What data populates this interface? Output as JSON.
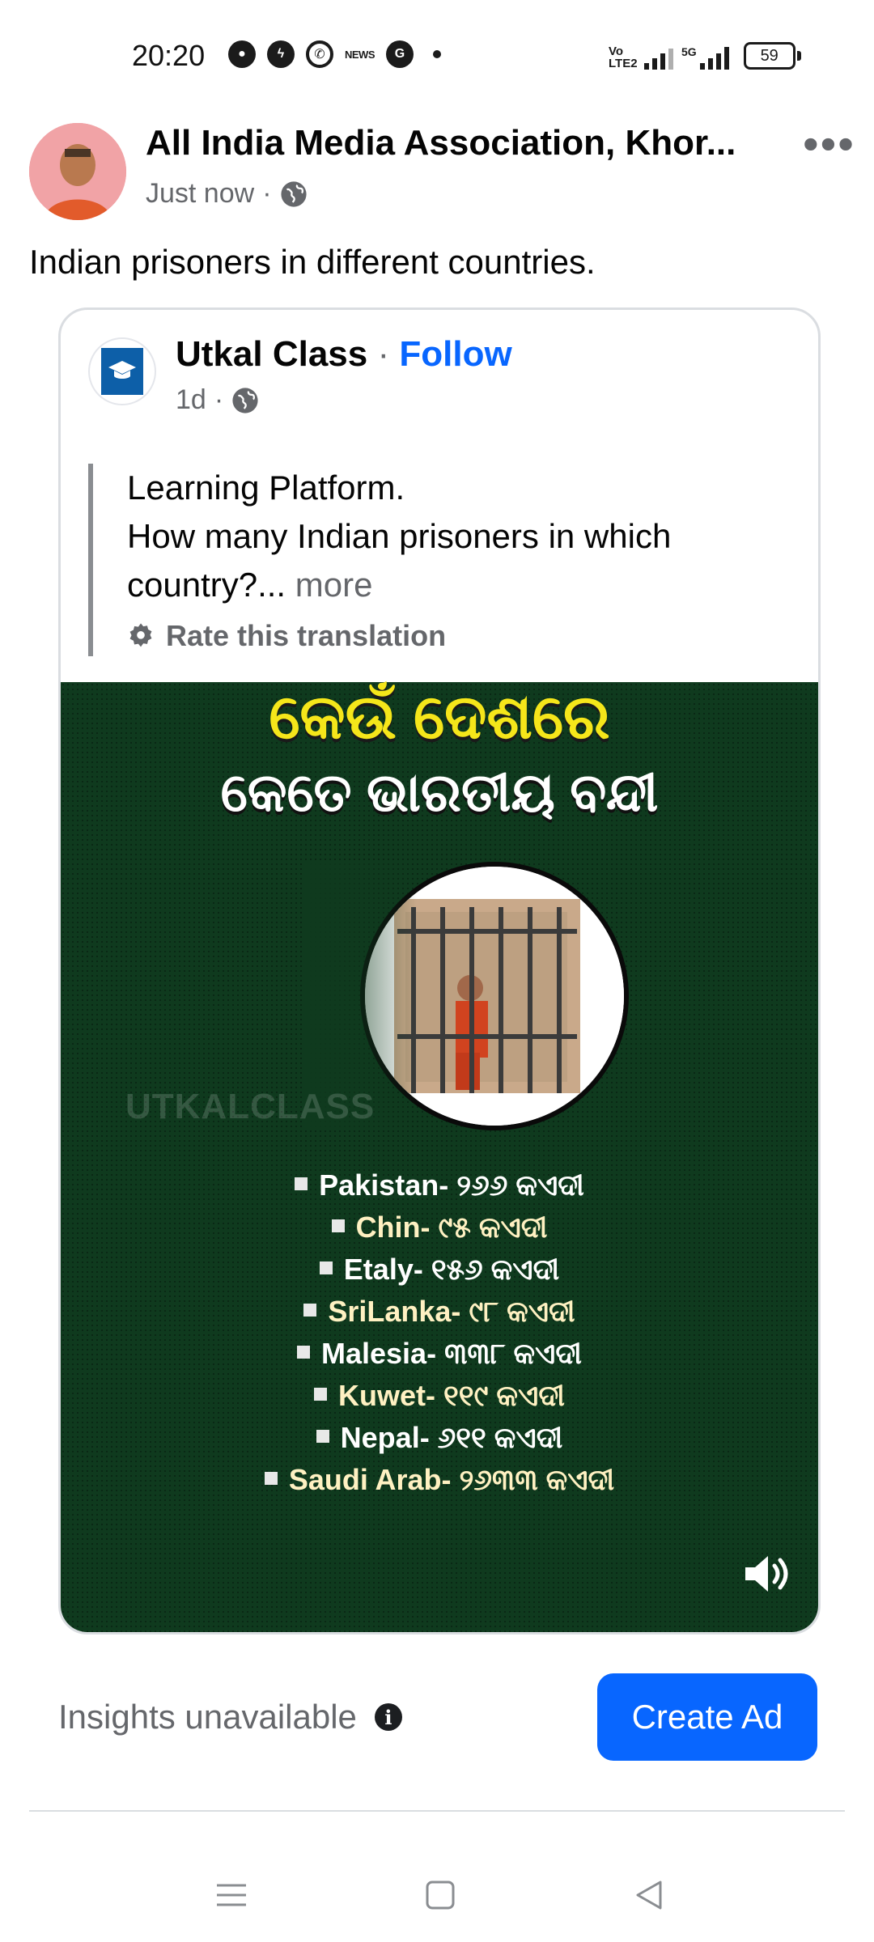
{
  "status_bar": {
    "time": "20:20",
    "news_label": "NEWS",
    "network_label": "Vo LTE2",
    "fiveg_label": "5G",
    "battery": "59"
  },
  "post": {
    "author": "All India Media Association, Khor...",
    "time": "Just now",
    "caption": "Indian prisoners in different countries."
  },
  "shared": {
    "page_name": "Utkal Class",
    "separator": "·",
    "follow_label": "Follow",
    "time": "1d",
    "text_lines": [
      "Learning Platform.",
      "How many Indian prisoners in which",
      "country?..."
    ],
    "more_label": "more",
    "rate_label": "Rate this translation"
  },
  "video": {
    "title_line1": "କେଉଁ ଦେଶରେ",
    "title_line2": "କେତେ ଭାରତୀୟ ବନ୍ଦୀ",
    "watermark": "UTKALCLASS",
    "items": [
      {
        "text": "Pakistan- ୨୬୬ କଏଦୀ",
        "style": "w"
      },
      {
        "text": "Chin- ୯୫ କଏଦୀ",
        "style": "y"
      },
      {
        "text": "Etaly- ୧୫୬ କଏଦୀ",
        "style": "w"
      },
      {
        "text": "SriLanka- ୯୮ କଏଦୀ",
        "style": "y"
      },
      {
        "text": "Malesia- ୩୩୮ କଏଦୀ",
        "style": "w"
      },
      {
        "text": "Kuwet- ୧୧୯ କଏଦୀ",
        "style": "y"
      },
      {
        "text": "Nepal- ୬୧୧ କଏଦୀ",
        "style": "w"
      },
      {
        "text": "Saudi Arab- ୨୬୩୩ କଏଦୀ",
        "style": "y"
      }
    ]
  },
  "footer": {
    "insights_label": "Insights unavailable",
    "create_ad_label": "Create Ad"
  },
  "colors": {
    "accent": "#0866ff",
    "video_bg": "#0f3a1e",
    "title_yellow": "#f5e61a"
  },
  "icons": [
    "globe-icon",
    "more-options-icon",
    "settings-gear-icon",
    "volume-icon",
    "info-icon",
    "menu-icon",
    "home-icon",
    "back-icon"
  ]
}
